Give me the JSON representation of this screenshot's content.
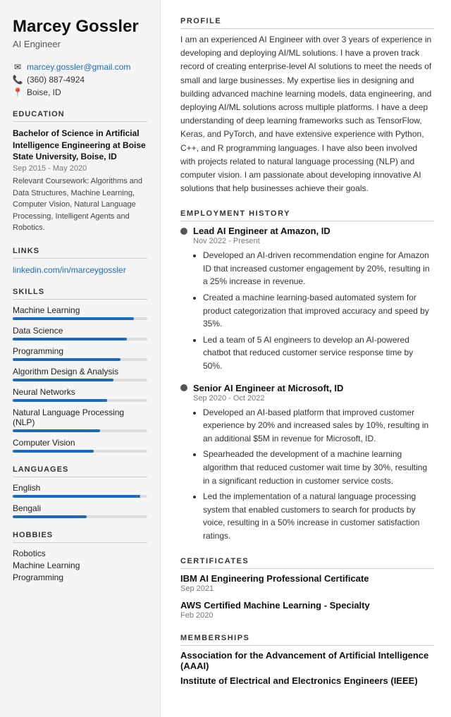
{
  "sidebar": {
    "name": "Marcey Gossler",
    "job_title": "AI Engineer",
    "contact": {
      "email": "marcey.gossler@gmail.com",
      "phone": "(360) 887-4924",
      "location": "Boise, ID"
    },
    "education": {
      "section_label": "Education",
      "degree": "Bachelor of Science in Artificial Intelligence Engineering at Boise State University, Boise, ID",
      "date": "Sep 2015 - May 2020",
      "coursework_label": "Relevant Coursework:",
      "coursework": "Algorithms and Data Structures, Machine Learning, Computer Vision, Natural Language Processing, Intelligent Agents and Robotics."
    },
    "links": {
      "section_label": "Links",
      "linkedin": "linkedin.com/in/marceygossler"
    },
    "skills": {
      "section_label": "Skills",
      "items": [
        {
          "label": "Machine Learning",
          "percent": 90
        },
        {
          "label": "Data Science",
          "percent": 85
        },
        {
          "label": "Programming",
          "percent": 80
        },
        {
          "label": "Algorithm Design & Analysis",
          "percent": 75
        },
        {
          "label": "Neural Networks",
          "percent": 70
        },
        {
          "label": "Natural Language Processing (NLP)",
          "percent": 65
        },
        {
          "label": "Computer Vision",
          "percent": 60
        }
      ]
    },
    "languages": {
      "section_label": "Languages",
      "items": [
        {
          "label": "English",
          "percent": 95
        },
        {
          "label": "Bengali",
          "percent": 55
        }
      ]
    },
    "hobbies": {
      "section_label": "Hobbies",
      "items": [
        "Robotics",
        "Machine Learning",
        "Programming"
      ]
    }
  },
  "main": {
    "profile": {
      "section_label": "Profile",
      "text": "I am an experienced AI Engineer with over 3 years of experience in developing and deploying AI/ML solutions. I have a proven track record of creating enterprise-level AI solutions to meet the needs of small and large businesses. My expertise lies in designing and building advanced machine learning models, data engineering, and deploying AI/ML solutions across multiple platforms. I have a deep understanding of deep learning frameworks such as TensorFlow, Keras, and PyTorch, and have extensive experience with Python, C++, and R programming languages. I have also been involved with projects related to natural language processing (NLP) and computer vision. I am passionate about developing innovative AI solutions that help businesses achieve their goals."
    },
    "employment": {
      "section_label": "Employment History",
      "jobs": [
        {
          "title": "Lead AI Engineer at Amazon, ID",
          "date": "Nov 2022 - Present",
          "bullets": [
            "Developed an AI-driven recommendation engine for Amazon ID that increased customer engagement by 20%, resulting in a 25% increase in revenue.",
            "Created a machine learning-based automated system for product categorization that improved accuracy and speed by 35%.",
            "Led a team of 5 AI engineers to develop an AI-powered chatbot that reduced customer service response time by 50%."
          ]
        },
        {
          "title": "Senior AI Engineer at Microsoft, ID",
          "date": "Sep 2020 - Oct 2022",
          "bullets": [
            "Developed an AI-based platform that improved customer experience by 20% and increased sales by 10%, resulting in an additional $5M in revenue for Microsoft, ID.",
            "Spearheaded the development of a machine learning algorithm that reduced customer wait time by 30%, resulting in a significant reduction in customer service costs.",
            "Led the implementation of a natural language processing system that enabled customers to search for products by voice, resulting in a 50% increase in customer satisfaction ratings."
          ]
        }
      ]
    },
    "certificates": {
      "section_label": "Certificates",
      "items": [
        {
          "name": "IBM AI Engineering Professional Certificate",
          "date": "Sep 2021"
        },
        {
          "name": "AWS Certified Machine Learning - Specialty",
          "date": "Feb 2020"
        }
      ]
    },
    "memberships": {
      "section_label": "Memberships",
      "items": [
        "Association for the Advancement of Artificial Intelligence (AAAI)",
        "Institute of Electrical and Electronics Engineers (IEEE)"
      ]
    }
  }
}
